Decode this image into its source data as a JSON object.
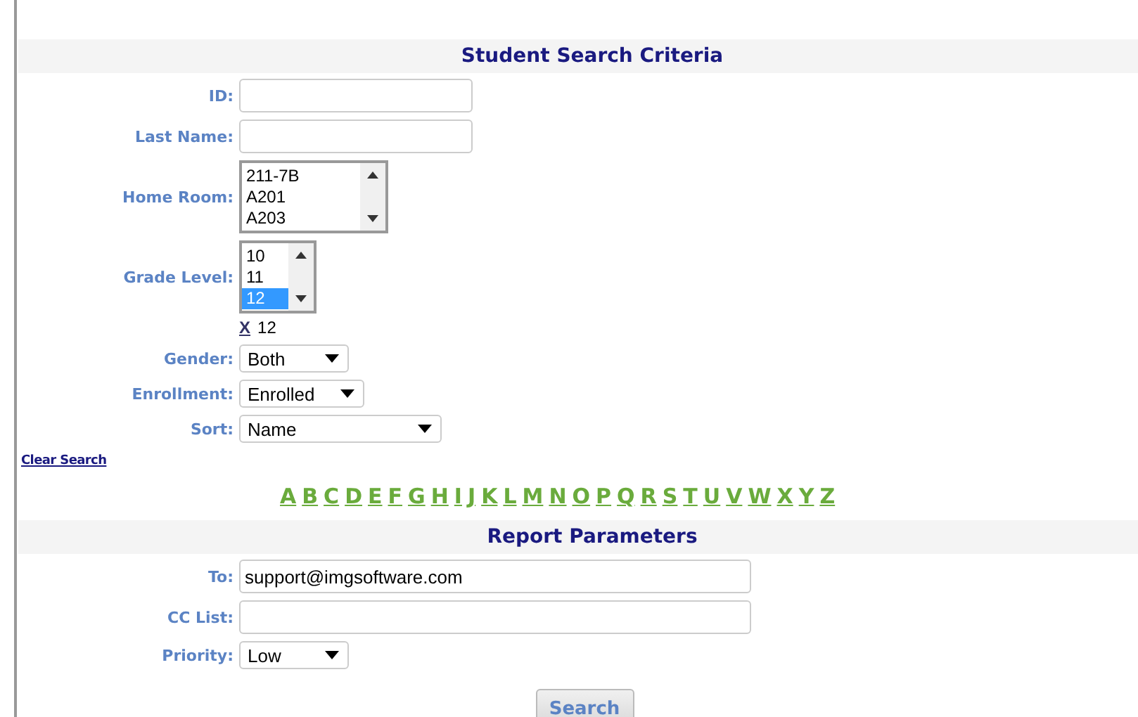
{
  "search_criteria": {
    "title": "Student Search Criteria",
    "fields": [
      {
        "kind": "text",
        "label": "ID:"
      },
      {
        "kind": "text",
        "label": "Last Name:"
      },
      {
        "kind": "listbox",
        "label": "Home Room:",
        "options": [
          {
            "label": "211-7B",
            "selected": false
          },
          {
            "label": "A201",
            "selected": false
          },
          {
            "label": "A203",
            "selected": false
          }
        ]
      },
      {
        "kind": "listbox",
        "label": "Grade Level:",
        "options": [
          {
            "label": "10",
            "selected": false
          },
          {
            "label": "11",
            "selected": false
          },
          {
            "label": "12",
            "selected": true
          }
        ],
        "chosen": {
          "remove": "X",
          "value": "12"
        }
      },
      {
        "kind": "select",
        "label": "Gender:",
        "value": "Both"
      },
      {
        "kind": "select",
        "label": "Enrollment:",
        "value": "Enrolled"
      },
      {
        "kind": "select",
        "label": "Sort:",
        "value": "Name"
      }
    ]
  },
  "clear_search": "Clear Search",
  "letters": [
    "A",
    "B",
    "C",
    "D",
    "E",
    "F",
    "G",
    "H",
    "I",
    "J",
    "K",
    "L",
    "M",
    "N",
    "O",
    "P",
    "Q",
    "R",
    "S",
    "T",
    "U",
    "V",
    "W",
    "X",
    "Y",
    "Z"
  ],
  "report_parameters": {
    "title": "Report Parameters",
    "fields": [
      {
        "kind": "email",
        "label": "To:",
        "value": "support@imgsoftware.com"
      },
      {
        "kind": "email",
        "label": "CC List:"
      },
      {
        "kind": "select",
        "label": "Priority:",
        "value": "Low"
      }
    ]
  },
  "search_button": "Search"
}
